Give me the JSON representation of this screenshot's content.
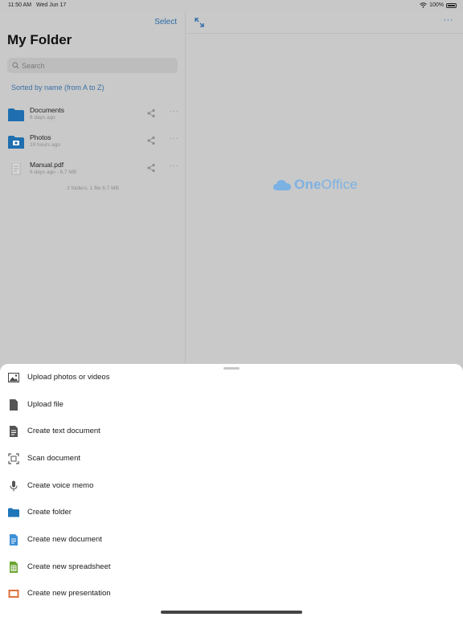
{
  "status": {
    "time": "11:50 AM",
    "date": "Wed Jun 17",
    "battery": "100%"
  },
  "left": {
    "select_label": "Select",
    "title": "My Folder",
    "search_placeholder": "Search",
    "sort_label": "Sorted by name (from A to Z)",
    "files": [
      {
        "name": "Documents",
        "meta": "6 days ago",
        "icon": "folder-icon"
      },
      {
        "name": "Photos",
        "meta": "19 hours ago",
        "icon": "photo-folder-icon"
      },
      {
        "name": "Manual.pdf",
        "meta": "6 days ago - 6.7 MB",
        "icon": "pdf-icon"
      }
    ],
    "summary": "2 folders, 1 file 6.7 MB"
  },
  "right": {
    "brand_one": "One",
    "brand_office": "Office",
    "more_label": "···"
  },
  "colors": {
    "accent": "#2a6aa6",
    "sheet_bg": "#ffffff",
    "dim_bg": "#c8c8c8",
    "brand": "#7cb1e3"
  },
  "sheet": {
    "items": [
      {
        "label": "Upload photos or videos",
        "icon": "image-icon"
      },
      {
        "label": "Upload file",
        "icon": "file-icon"
      },
      {
        "label": "Create text document",
        "icon": "text-doc-icon"
      },
      {
        "label": "Scan document",
        "icon": "scan-icon"
      },
      {
        "label": "Create voice memo",
        "icon": "microphone-icon"
      },
      {
        "label": "Create folder",
        "icon": "folder-icon"
      },
      {
        "label": "Create new document",
        "icon": "document-icon"
      },
      {
        "label": "Create new spreadsheet",
        "icon": "spreadsheet-icon"
      },
      {
        "label": "Create new presentation",
        "icon": "presentation-icon"
      }
    ]
  }
}
